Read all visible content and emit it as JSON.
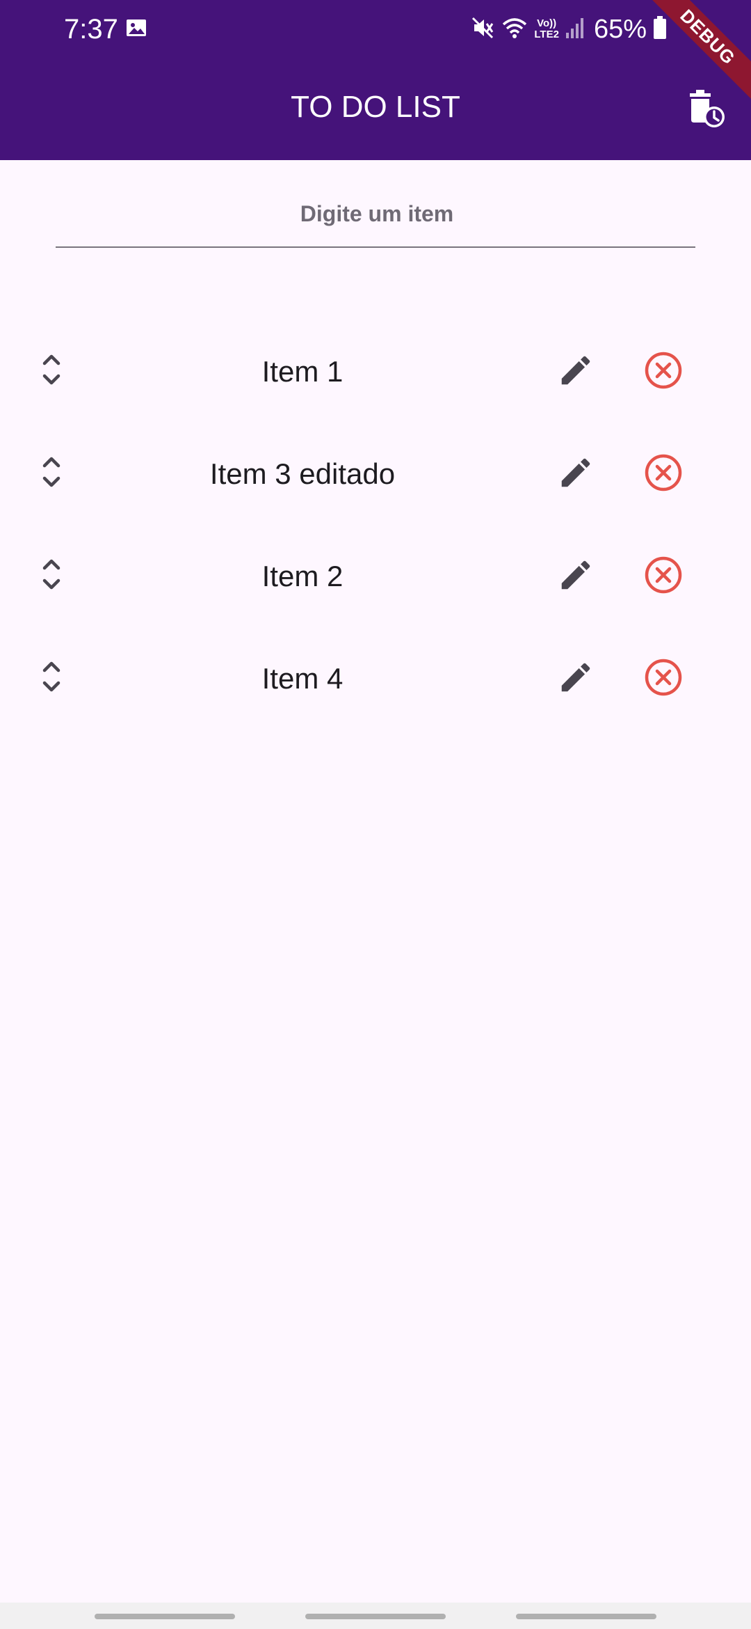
{
  "status_bar": {
    "time": "7:37",
    "battery": "65%",
    "volte_top": "Vo))",
    "volte_bottom": "LTE2",
    "icons": [
      "gallery-icon",
      "mute-icon",
      "wifi-icon",
      "volte-icon",
      "signal-icon",
      "battery-icon"
    ]
  },
  "debug_banner": "DEBUG",
  "app_bar": {
    "title": "TO DO LIST",
    "action_icon": "delete-history-icon",
    "color": "#45137A"
  },
  "input": {
    "placeholder": "Digite um item",
    "value": ""
  },
  "items": [
    {
      "label": "Item 1"
    },
    {
      "label": "Item 3 editado"
    },
    {
      "label": "Item 2"
    },
    {
      "label": "Item 4"
    }
  ],
  "colors": {
    "background": "#FEF7FF",
    "delete": "#E5534B",
    "icon": "#49454F"
  }
}
